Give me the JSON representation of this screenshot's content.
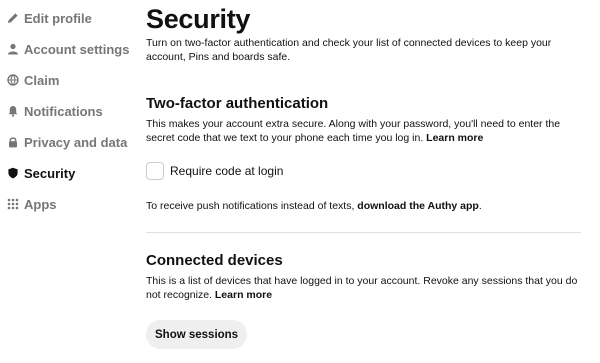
{
  "sidebar": {
    "items": [
      {
        "label": "Edit profile",
        "icon": "pencil-icon",
        "active": false
      },
      {
        "label": "Account settings",
        "icon": "person-icon",
        "active": false
      },
      {
        "label": "Claim",
        "icon": "globe-icon",
        "active": false
      },
      {
        "label": "Notifications",
        "icon": "bell-icon",
        "active": false
      },
      {
        "label": "Privacy and data",
        "icon": "lock-icon",
        "active": false
      },
      {
        "label": "Security",
        "icon": "shield-icon",
        "active": true
      },
      {
        "label": "Apps",
        "icon": "grid-icon",
        "active": false
      }
    ]
  },
  "main": {
    "title": "Security",
    "intro": "Turn on two-factor authentication and check your list of connected devices to keep your account, Pins and boards safe.",
    "two_factor": {
      "heading": "Two-factor authentication",
      "description": "This makes your account extra secure. Along with your password, you'll need to enter the secret code that we text to your phone each time you log in.",
      "learn_more": "Learn more",
      "checkbox_label": "Require code at login",
      "checkbox_checked": false,
      "push_text": "To receive push notifications instead of texts,",
      "push_link": "download the Authy app",
      "push_suffix": "."
    },
    "devices": {
      "heading": "Connected devices",
      "description": "This is a list of devices that have logged in to your account. Revoke any sessions that you do not recognize.",
      "learn_more": "Learn more",
      "button_label": "Show sessions"
    }
  },
  "colors": {
    "text": "#111111",
    "muted": "#767676",
    "button_bg": "#efefef",
    "divider": "#e0e0e0"
  }
}
